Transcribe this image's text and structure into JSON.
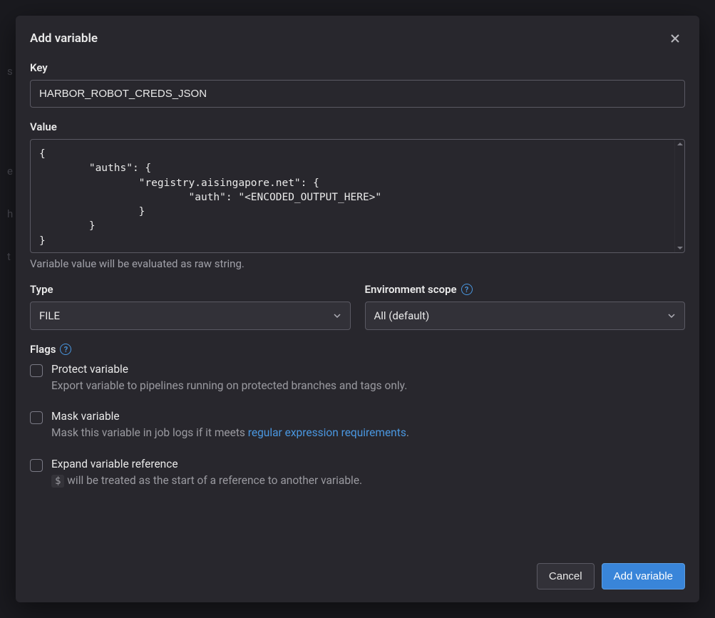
{
  "modal": {
    "title": "Add variable",
    "key_label": "Key",
    "key_value": "HARBOR_ROBOT_CREDS_JSON",
    "value_label": "Value",
    "value_text": "{\n        \"auths\": {\n                \"registry.aisingapore.net\": {\n                        \"auth\": \"<ENCODED_OUTPUT_HERE>\"\n                }\n        }\n}",
    "value_hint": "Variable value will be evaluated as raw string.",
    "type_label": "Type",
    "type_value": "FILE",
    "scope_label": "Environment scope",
    "scope_value": "All (default)",
    "flags_label": "Flags",
    "flags": {
      "protect": {
        "title": "Protect variable",
        "desc": "Export variable to pipelines running on protected branches and tags only."
      },
      "mask": {
        "title": "Mask variable",
        "desc_prefix": "Mask this variable in job logs if it meets ",
        "desc_link": "regular expression requirements",
        "desc_suffix": "."
      },
      "expand": {
        "title": "Expand variable reference",
        "symbol": "$",
        "desc_after": " will be treated as the start of a reference to another variable."
      }
    },
    "buttons": {
      "cancel": "Cancel",
      "submit": "Add variable"
    }
  }
}
